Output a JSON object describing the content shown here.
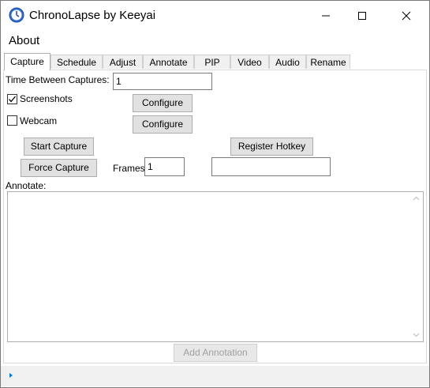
{
  "window": {
    "title": "ChronoLapse by Keeyai"
  },
  "menu": {
    "about": "About"
  },
  "tabs": [
    "Capture",
    "Schedule",
    "Adjust",
    "Annotate",
    "PIP",
    "Video",
    "Audio",
    "Rename"
  ],
  "capture": {
    "time_between_label": "Time Between Captures:",
    "time_between_value": "1",
    "screenshots_label": "Screenshots",
    "screenshots_checked": true,
    "webcam_label": "Webcam",
    "webcam_checked": false,
    "configure_label": "Configure",
    "start_capture": "Start Capture",
    "force_capture": "Force Capture",
    "frames_label": "Frames",
    "frames_value": "1",
    "register_hotkey": "Register Hotkey",
    "hotkey_value": "",
    "annotate_label": "Annotate:",
    "annotate_value": "",
    "add_annotation": "Add Annotation"
  },
  "icons": {
    "app": "chronolapse-clock-icon",
    "minimize": "minimize-icon",
    "maximize": "maximize-icon",
    "close": "close-icon"
  },
  "colors": {
    "accent": "#0078d7",
    "button_face": "#e1e1e1",
    "disabled_text": "#a0a0a0"
  }
}
